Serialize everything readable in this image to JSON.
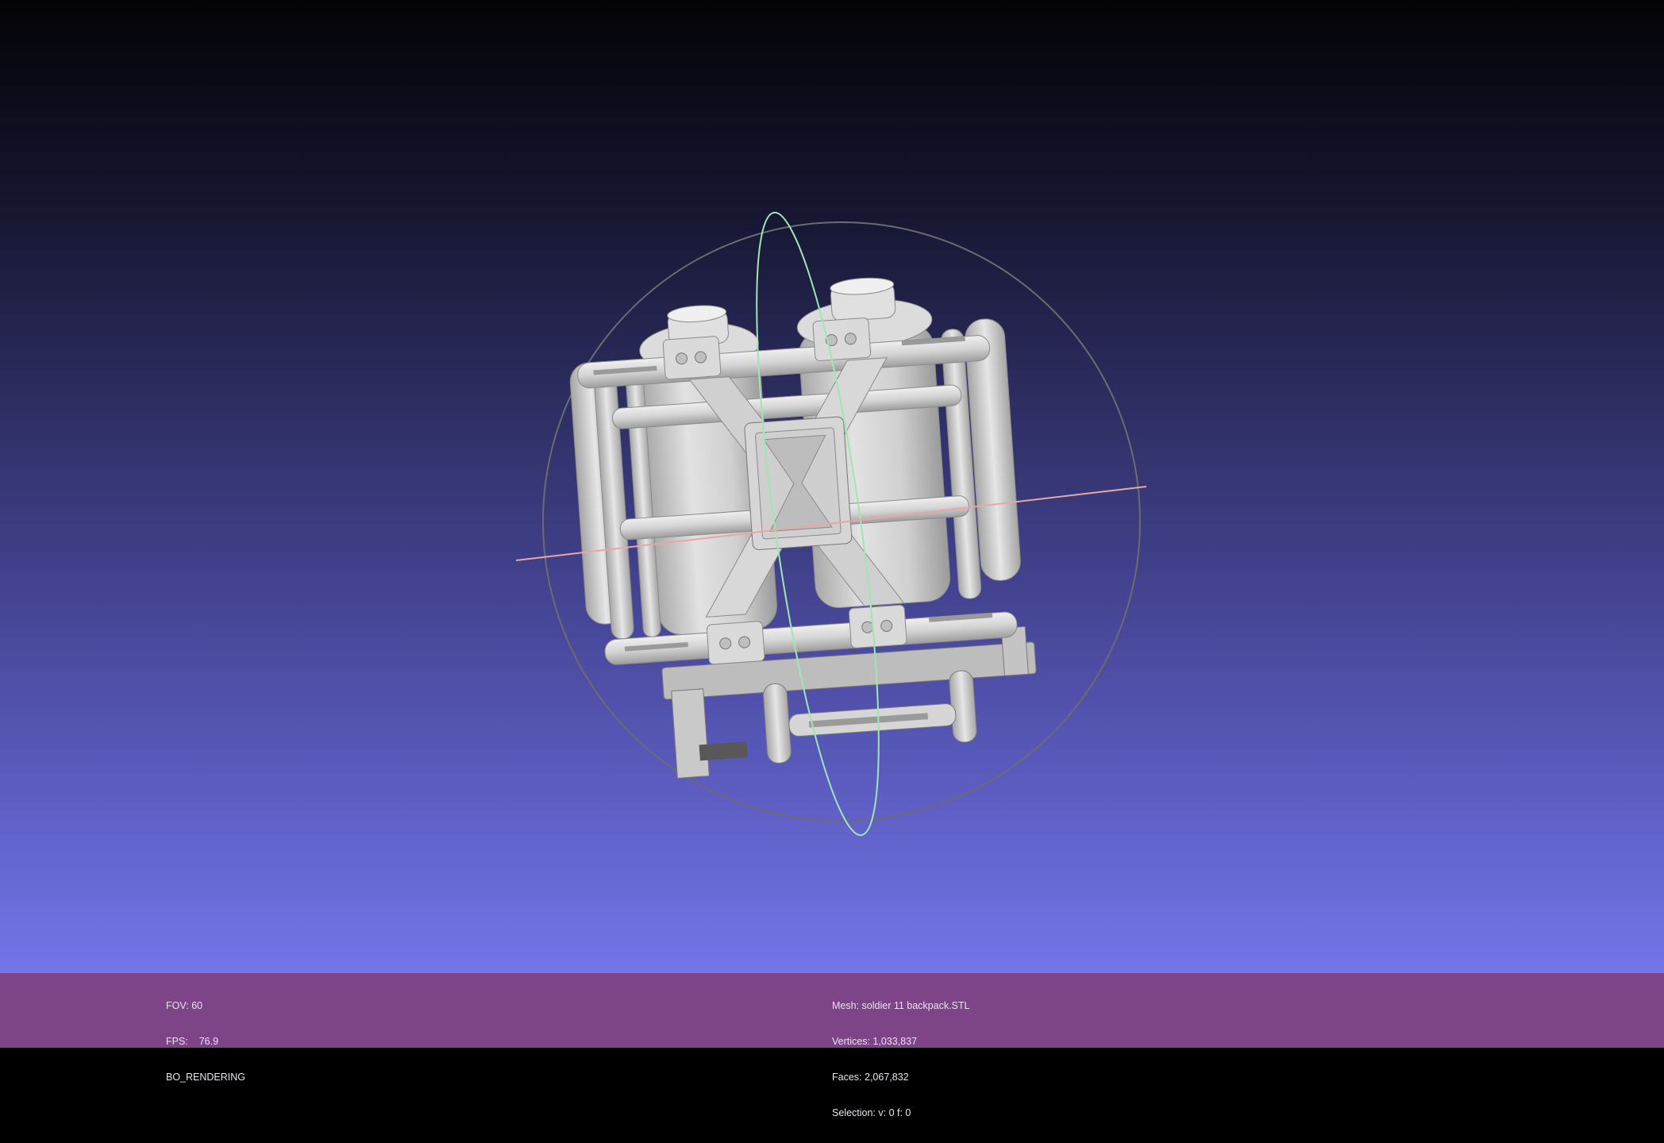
{
  "status_left": {
    "fov_label": "FOV:",
    "fov_value": "60",
    "fps_label": "FPS:",
    "fps_value": "76.9",
    "render_mode": "BO_RENDERING"
  },
  "status_right": {
    "mesh_label": "Mesh:",
    "mesh_value": "soldier 11 backpack.STL",
    "vertices_label": "Vertices:",
    "vertices_value": "1,033,837",
    "faces_label": "Faces:",
    "faces_value": "2,067,832",
    "selection_label": "Selection:",
    "selection_value": "v: 0 f: 0"
  },
  "colors": {
    "background_top": "#030306",
    "background_bottom": "#7575ea",
    "info_bar": "#7d4587",
    "mesh": "#d3d3d3",
    "trackball_ring": "#6b6b72",
    "axis_green": "#9fe6b4",
    "axis_red": "#e8a6a6"
  }
}
